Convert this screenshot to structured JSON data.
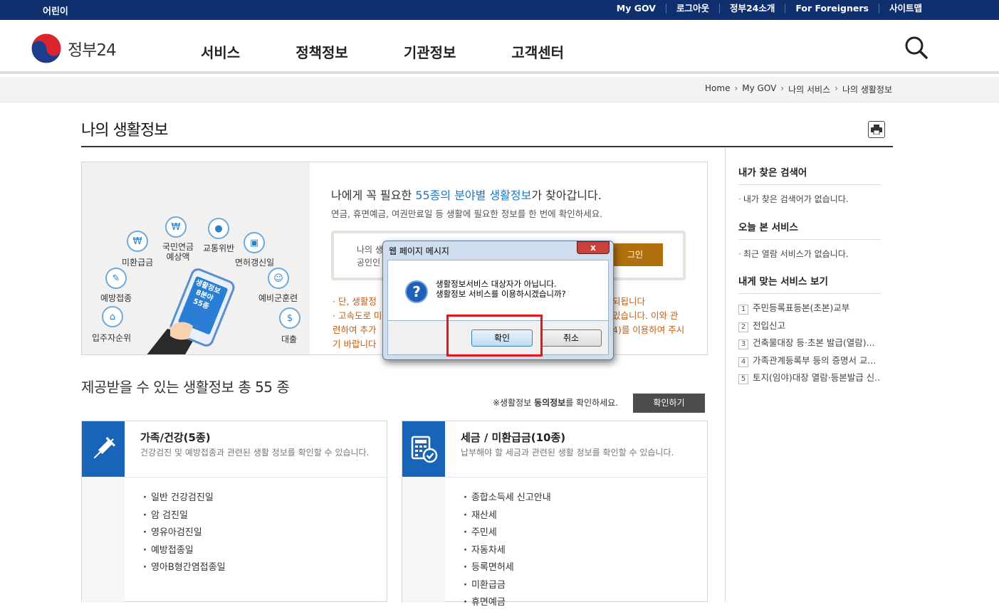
{
  "topbar": {
    "kids": "어린이",
    "links": [
      "My GOV",
      "로그아웃",
      "정부24소개",
      "For Foreigners",
      "사이트맵"
    ]
  },
  "header": {
    "logo_text": "정부24",
    "nav": [
      "서비스",
      "정책정보",
      "기관정보",
      "고객센터"
    ]
  },
  "breadcrumb": [
    "Home",
    "My GOV",
    "나의 서비스",
    "나의 생활정보"
  ],
  "page_title": "나의 생활정보",
  "promo": {
    "head_pre": "나에게 꼭 필요한 ",
    "head_blue": "55종의 분야별 생활정보",
    "head_post": "가 찾아갑니다.",
    "sub": "연금, 휴면예금, 여권만료일 등 생활에 필요한 정보를 한 번에 확인하세요.",
    "login_text_1": "나의 생",
    "login_text_2": "공인인",
    "login_btn": "그인",
    "note1": "· 단, 생활정",
    "note2": "· 고속도로 미",
    "note3": "  련하여 추가",
    "note4": "  기 바랍니다",
    "note1_r": "되됩니다",
    "note2_r": "있습니다. 이와 관",
    "note3_r": "4)를 이용하여 주시",
    "labels": {
      "refund": "미환급금",
      "pension": "국민연금\n예상액",
      "traffic": "교통위반",
      "license": "면허갱신일",
      "vaccine": "예방접종",
      "reserve": "예비군훈련",
      "housing": "입주자순위",
      "loan": "대출"
    },
    "phone_text": "생활정보\n8분야\n55종"
  },
  "available": {
    "title": "제공받을 수 있는 생활정보 총 55 종",
    "consent_pre": "※생활정보 ",
    "consent_bold": "동의정보",
    "consent_post": "를 확인하세요.",
    "confirm_btn": "확인하기"
  },
  "cards": [
    {
      "title": "가족/건강(5종)",
      "desc": "건강검진 및 예방접종과 관련된 생활 정보를 확인할 수 있습니다.",
      "items": [
        "일반 건강검진일",
        "암 검진일",
        "영유아검진일",
        "예방접종일",
        "영아B형간염접종일"
      ]
    },
    {
      "title": "세금 / 미환급금(10종)",
      "desc": "납부해야 할 세금과 관련된 생활 정보를 확인할 수 있습니다.",
      "items": [
        "종합소득세 신고안내",
        "재산세",
        "주민세",
        "자동차세",
        "등록면허세",
        "미환급금",
        "휴면예금"
      ]
    }
  ],
  "sidebar": {
    "search_title": "내가 찾은 검색어",
    "search_empty": "내가 찾은 검색어가 없습니다.",
    "today_title": "오늘 본 서비스",
    "today_empty": "최근 열람 서비스가 없습니다.",
    "match_title": "내게 맞는 서비스 보기",
    "match_items": [
      "주민등록표등본(초본)교부",
      "전입신고",
      "건축물대장 등·초본 발급(열람)...",
      "가족관계등록부 등의 증명서 교...",
      "토지(임야)대장 열람·등본발급 신..."
    ]
  },
  "dialog": {
    "title": "웹 페이지 메시지",
    "line1": "생활정보서비스 대상자가 아닙니다.",
    "line2": "생활정보 서비스를 이용하시겠습니까?",
    "ok": "확인",
    "cancel": "취소",
    "close": "x"
  }
}
